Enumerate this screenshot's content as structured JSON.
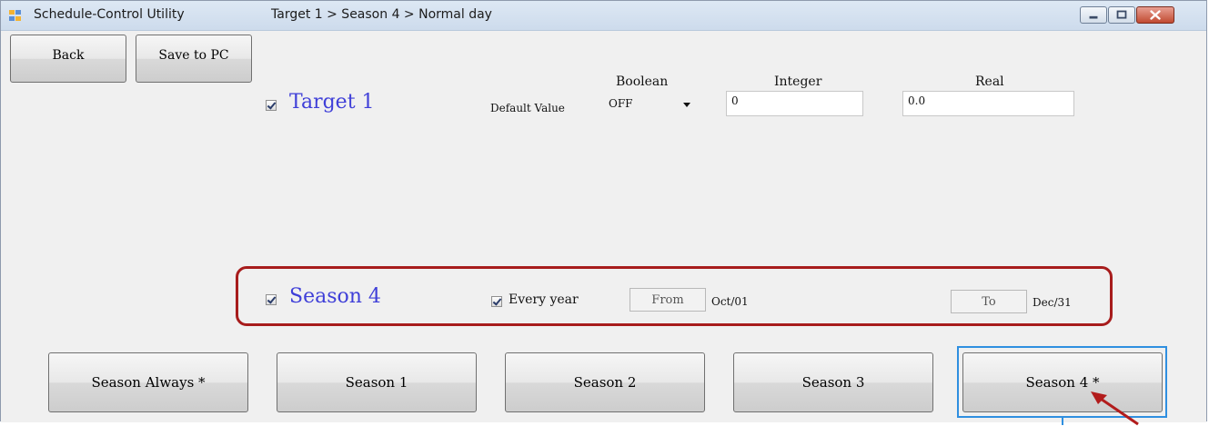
{
  "window": {
    "app_title": "Schedule-Control Utility",
    "breadcrumb": "Target 1 > Season 4 > Normal day"
  },
  "toolbar": {
    "back_label": "Back",
    "save_label": "Save to PC"
  },
  "target": {
    "label": "Target 1",
    "checked": true
  },
  "defaults": {
    "row_label": "Default Value",
    "boolean_header": "Boolean",
    "integer_header": "Integer",
    "real_header": "Real",
    "boolean_value": "OFF",
    "integer_value": "0",
    "real_value": "0.0"
  },
  "season": {
    "label": "Season 4",
    "checked": true,
    "every_year_label": "Every year",
    "every_year_checked": true,
    "from_label": "From",
    "from_value": "Oct/01",
    "to_label": "To",
    "to_value": "Dec/31"
  },
  "season_tabs": [
    {
      "label": "Season Always *"
    },
    {
      "label": "Season 1"
    },
    {
      "label": "Season 2"
    },
    {
      "label": "Season 3"
    },
    {
      "label": "Season 4 *",
      "selected": true
    }
  ],
  "colors": {
    "accent_blue_text": "#3f3fd8",
    "highlight_frame": "#a71c1c",
    "focus_frame": "#2f8fe0"
  },
  "icons": [
    "app-icon",
    "minimize-icon",
    "maximize-icon",
    "close-icon",
    "checkbox-checked-icon",
    "dropdown-arrow-icon",
    "pointer-arrow"
  ]
}
